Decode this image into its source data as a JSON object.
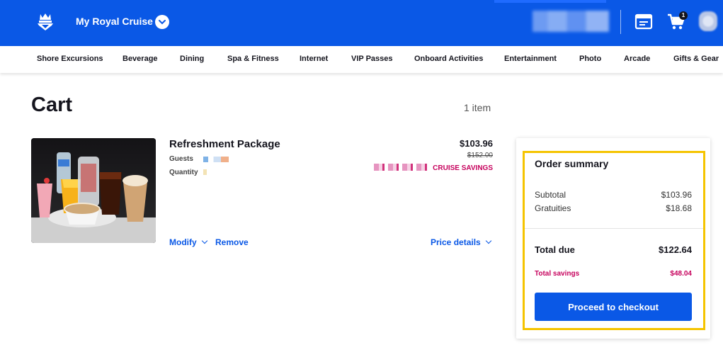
{
  "header": {
    "brand": "My Royal Cruise",
    "cart_count": "1",
    "colors": {
      "primary": "#0a58e6",
      "savings": "#c6005c",
      "highlight": "#f5c400"
    }
  },
  "nav": {
    "items": [
      {
        "label": "Shore Excursions"
      },
      {
        "label": "Beverage"
      },
      {
        "label": "Dining"
      },
      {
        "label": "Spa & Fitness"
      },
      {
        "label": "Internet"
      },
      {
        "label": "VIP Passes"
      },
      {
        "label": "Onboard Activities"
      },
      {
        "label": "Entertainment"
      },
      {
        "label": "Photo"
      },
      {
        "label": "Arcade"
      },
      {
        "label": "Gifts & Gear"
      }
    ]
  },
  "cart": {
    "title": "Cart",
    "item_count": "1 item"
  },
  "item": {
    "name": "Refreshment Package",
    "guests_label": "Guests",
    "quantity_label": "Quantity",
    "price": "$103.96",
    "original_price": "$152.00",
    "savings_label": "CRUISE SAVINGS",
    "modify_label": "Modify",
    "remove_label": "Remove",
    "price_details_label": "Price details"
  },
  "summary": {
    "title": "Order summary",
    "subtotal_label": "Subtotal",
    "subtotal_value": "$103.96",
    "gratuities_label": "Gratuities",
    "gratuities_value": "$18.68",
    "total_label": "Total due",
    "total_value": "$122.64",
    "savings_label": "Total savings",
    "savings_value": "$48.04",
    "checkout_label": "Proceed to checkout"
  }
}
